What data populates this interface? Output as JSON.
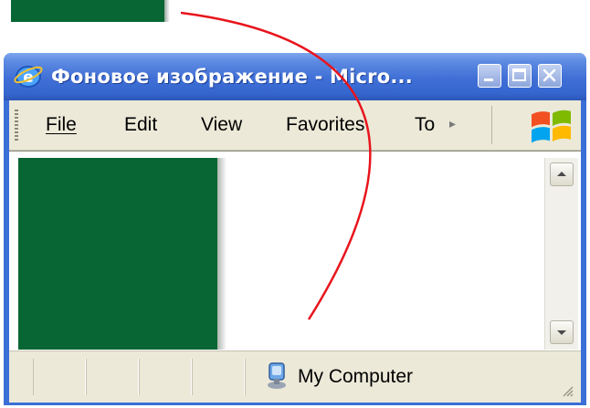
{
  "swatch": {
    "color": "#076633"
  },
  "window": {
    "title": "Фоновое изображение - Micro...",
    "controls": {
      "minimize_icon": "minimize-icon",
      "maximize_icon": "maximize-icon",
      "close_icon": "close-icon"
    }
  },
  "menubar": {
    "items": [
      {
        "label": "File"
      },
      {
        "label": "Edit"
      },
      {
        "label": "View"
      },
      {
        "label": "Favorites"
      },
      {
        "label": "To"
      }
    ],
    "overflow_icon": "chevron-right-icon",
    "logo_icon": "windows-logo-icon"
  },
  "content": {
    "background_color": "#ffffff",
    "panel_color": "#076633"
  },
  "statusbar": {
    "zone_label": "My Computer",
    "zone_icon": "my-computer-icon"
  },
  "annotation": {
    "color": "#e8141c",
    "icon": "curved-arrow-annotation"
  }
}
